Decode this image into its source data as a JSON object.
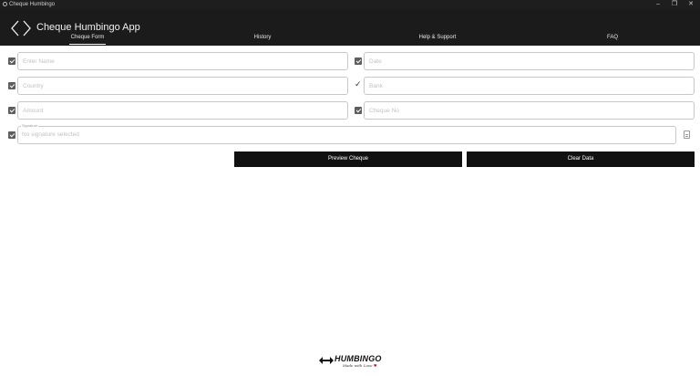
{
  "window": {
    "title": "Cheque Humbingo",
    "controls": {
      "minimize": "–",
      "restore": "❐",
      "close": "✕"
    }
  },
  "header": {
    "app_title": "Cheque Humbingo App",
    "tabs": [
      {
        "label": "Cheque Form",
        "active": true
      },
      {
        "label": "History",
        "active": false
      },
      {
        "label": "Help & Support",
        "active": false
      },
      {
        "label": "FAQ",
        "active": false
      }
    ]
  },
  "form": {
    "name": {
      "placeholder": "Enter Name",
      "value": ""
    },
    "date": {
      "placeholder": "Date",
      "value": ""
    },
    "country": {
      "placeholder": "Country",
      "value": ""
    },
    "bank": {
      "placeholder": "Bank",
      "value": ""
    },
    "amount": {
      "placeholder": "Amount",
      "value": ""
    },
    "cheque_no": {
      "placeholder": "Cheque No",
      "value": ""
    },
    "signature": {
      "label": "Signature",
      "placeholder": "No signature selected"
    }
  },
  "actions": {
    "preview_label": "Preview Cheque",
    "clear_label": "Clear Data"
  },
  "footer": {
    "brand": "HUMBINGO",
    "tagline": "Made with Love"
  },
  "colors": {
    "header_bg": "#1b1b1b",
    "button_bg": "#111111",
    "accent_heart": "#d0021b"
  }
}
